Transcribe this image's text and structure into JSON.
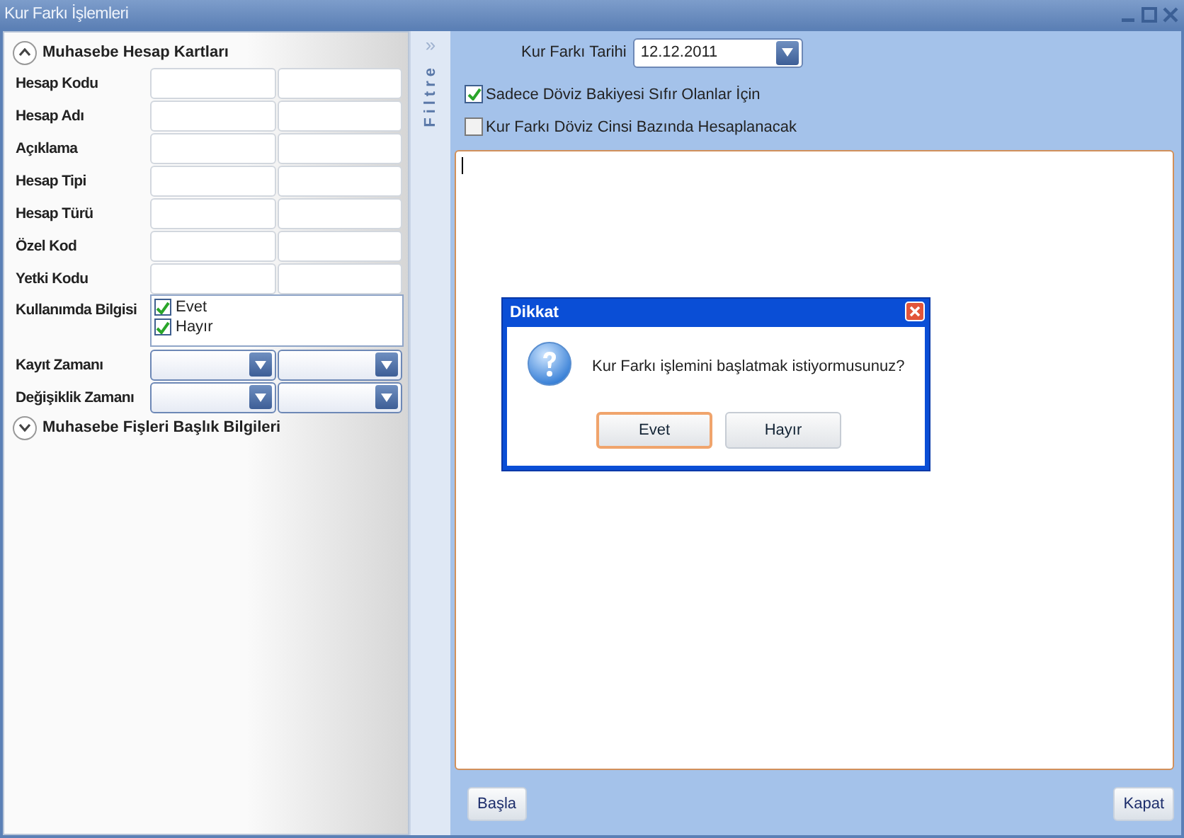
{
  "window": {
    "title": "Kur Farkı İşlemleri"
  },
  "filter_panel": {
    "sections": [
      {
        "title": "Muhasebe Hesap Kartları",
        "expanded": true,
        "fields": [
          {
            "kind": "text",
            "label": "Hesap Kodu"
          },
          {
            "kind": "text",
            "label": "Hesap Adı"
          },
          {
            "kind": "text",
            "label": "Açıklama"
          },
          {
            "kind": "text",
            "label": "Hesap Tipi"
          },
          {
            "kind": "text",
            "label": "Hesap Türü"
          },
          {
            "kind": "text",
            "label": "Özel Kod"
          },
          {
            "kind": "text",
            "label": "Yetki Kodu"
          },
          {
            "kind": "checklist",
            "label": "Kullanımda Bilgisi",
            "options": [
              {
                "label": "Evet",
                "checked": true
              },
              {
                "label": "Hayır",
                "checked": true
              }
            ]
          },
          {
            "kind": "combo",
            "label": "Kayıt Zamanı"
          },
          {
            "kind": "combo",
            "label": "Değişiklik Zamanı"
          }
        ]
      },
      {
        "title": "Muhasebe Fişleri Başlık Bilgileri",
        "expanded": false
      }
    ],
    "strip": {
      "arrow": "»",
      "label": "Filtre"
    }
  },
  "main": {
    "date_label": "Kur Farkı Tarihi",
    "date_value": "12.12.2011",
    "options": [
      {
        "label": "Sadece Döviz Bakiyesi Sıfır Olanlar İçin",
        "checked": true
      },
      {
        "label": "Kur Farkı Döviz Cinsi Bazında Hesaplanacak",
        "checked": false
      }
    ],
    "buttons": [
      {
        "label": "Başla"
      },
      {
        "label": "Kapat"
      }
    ]
  },
  "dialog": {
    "title": "Dikkat",
    "message": "Kur Farkı işlemini başlatmak istiyormusunuz?",
    "buttons": [
      {
        "label": "Evet",
        "focused": true
      },
      {
        "label": "Hayır",
        "focused": false
      }
    ]
  }
}
